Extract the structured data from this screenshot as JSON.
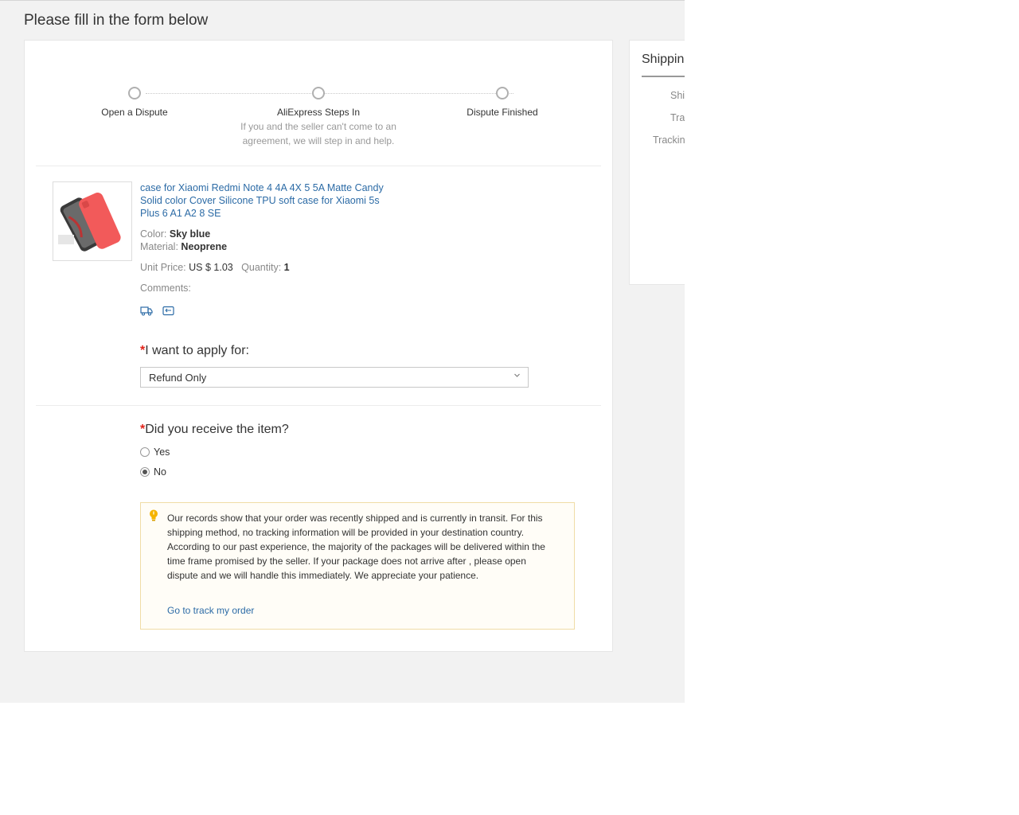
{
  "page": {
    "title": "Please fill in the form below"
  },
  "steps": [
    {
      "label": "Open a Dispute",
      "desc": ""
    },
    {
      "label": "AliExpress Steps In",
      "desc": "If you and the seller can't come to an agreement, we will step in and help."
    },
    {
      "label": "Dispute Finished",
      "desc": ""
    }
  ],
  "product": {
    "title": "case for Xiaomi Redmi Note 4 4A 4X 5 5A Matte Candy Solid color Cover Silicone TPU soft case for Xiaomi 5s Plus 6 A1 A2 8 SE",
    "color_label": "Color:",
    "color_value": "Sky blue",
    "material_label": "Material:",
    "material_value": "Neoprene",
    "unit_price_label": "Unit Price:",
    "unit_price_value": "US $ 1.03",
    "quantity_label": "Quantity:",
    "quantity_value": "1",
    "comments_label": "Comments:"
  },
  "apply": {
    "required_mark": "*",
    "label": "I want to apply for:",
    "selected": "Refund Only"
  },
  "received": {
    "required_mark": "*",
    "label": "Did you receive the item?",
    "options": [
      {
        "label": "Yes",
        "checked": false
      },
      {
        "label": "No",
        "checked": true
      }
    ]
  },
  "notice": {
    "text": "Our records show that your order was recently shipped and is currently in transit. For this shipping method, no tracking information will be provided in your destination country. According to our past experience, the majority of the packages will be delivered within the time frame promised by the seller. If your package does not arrive after , please open dispute and we will handle this immediately. We appreciate your patience.",
    "link": "Go to track my order",
    "icon": "lightbulb-icon"
  },
  "shipping": {
    "title": "Shippin",
    "fields": [
      "Shi",
      "Tra",
      "Trackin"
    ]
  },
  "colors": {
    "accent_link": "#2c6ba6",
    "required": "#e2231a",
    "notice_border": "#f0dca6"
  }
}
